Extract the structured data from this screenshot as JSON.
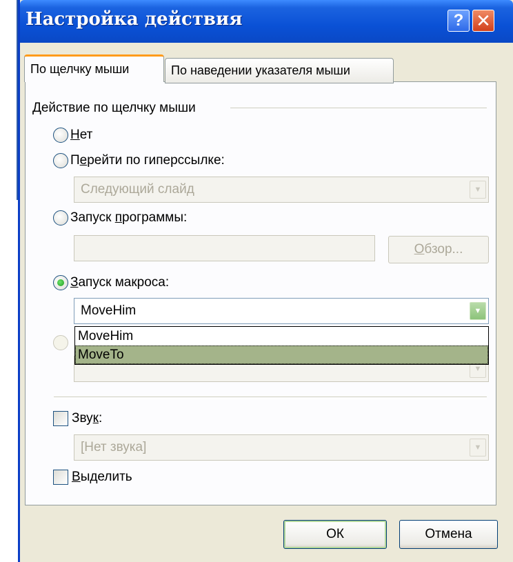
{
  "window": {
    "title": "Настройка действия",
    "help_symbol": "?",
    "close_symbol": "✕"
  },
  "tabs": [
    {
      "label": "По щелчку мыши",
      "active": true
    },
    {
      "label": "По наведении указателя мыши",
      "active": false
    }
  ],
  "group": {
    "label": "Действие по щелчку мыши"
  },
  "options": {
    "none": {
      "label_pre": "",
      "label_u": "Н",
      "label_post": "ет",
      "checked": false
    },
    "hyperlink": {
      "label_pre": "П",
      "label_u": "е",
      "label_post": "рейти по гиперссылке:",
      "checked": false,
      "value": "Следующий слайд"
    },
    "run_program": {
      "label_pre": "Запуск ",
      "label_u": "п",
      "label_post": "рограммы:",
      "checked": false,
      "browse_pre": "",
      "browse_u": "О",
      "browse_post": "бзор..."
    },
    "run_macro": {
      "label_pre": "",
      "label_u": "З",
      "label_post": "апуск макроса:",
      "checked": true,
      "value": "MoveHim"
    }
  },
  "macro_dropdown": {
    "items": [
      "MoveHim",
      "MoveTo"
    ],
    "selected_index": 1
  },
  "sound": {
    "label_pre": "Зву",
    "label_u": "к",
    "label_post": ":",
    "checked": false,
    "value": "[Нет звука]"
  },
  "highlight": {
    "label_pre": "",
    "label_u": "В",
    "label_post": "ыделить",
    "checked": false
  },
  "buttons": {
    "ok": "ОК",
    "cancel": "Отмена"
  },
  "icons": {
    "combo_arrow": "▼"
  }
}
